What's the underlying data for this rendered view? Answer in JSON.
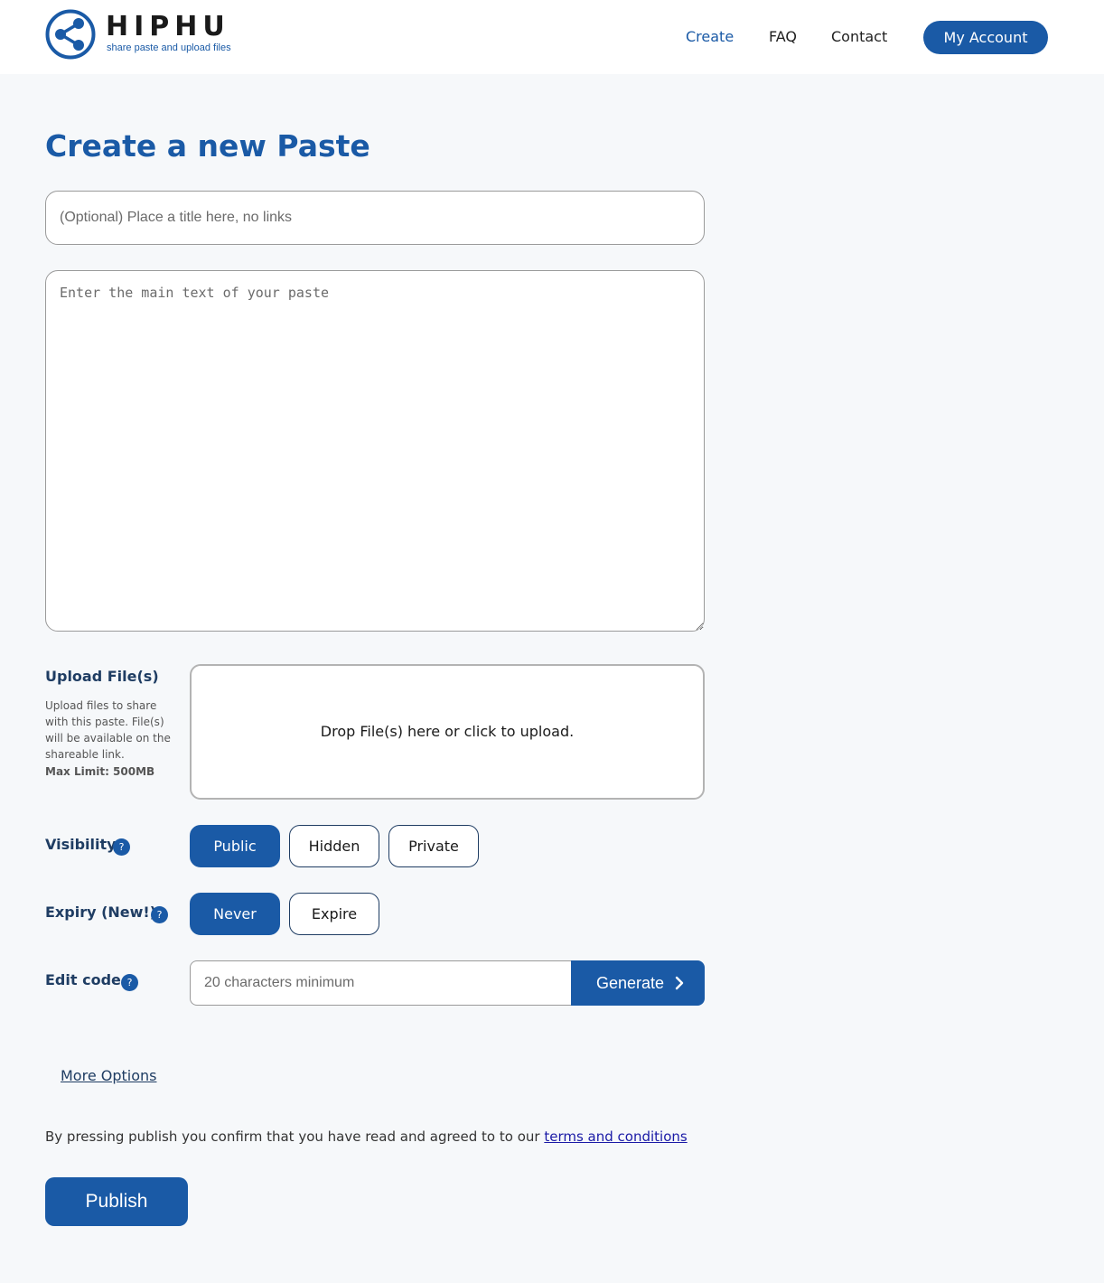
{
  "header": {
    "logo_word": "HIPHU",
    "logo_tagline": "share paste and upload files",
    "nav": {
      "create": "Create",
      "faq": "FAQ",
      "contact": "Contact"
    },
    "account_label": "My Account"
  },
  "main": {
    "title": "Create a new Paste",
    "title_input": {
      "placeholder": "(Optional) Place a title here, no links",
      "value": ""
    },
    "text_area": {
      "placeholder": "Enter the main text of your paste",
      "value": ""
    },
    "upload": {
      "heading": "Upload File(s)",
      "description": "Upload files to share with this paste. File(s) will be available on the shareable link.",
      "limit": "Max Limit: 500MB",
      "dropzone_text": "Drop File(s) here or click to upload."
    },
    "visibility": {
      "label": "Visibility",
      "help": "?",
      "options": [
        "Public",
        "Hidden",
        "Private"
      ],
      "selected": "Public"
    },
    "expiry": {
      "label": "Expiry (New!):",
      "help": "?",
      "options": [
        "Never",
        "Expire"
      ],
      "selected": "Never"
    },
    "edit_code": {
      "label": "Edit code",
      "help": "?",
      "placeholder": "20 characters minimum",
      "value": "",
      "generate_label": "Generate"
    },
    "more_options": "More Options",
    "terms": {
      "prefix": "By pressing publish you confirm that you have read and agreed to to our ",
      "link_text": "terms and conditions"
    },
    "publish_label": "Publish"
  },
  "colors": {
    "brand": "#1a5aa6",
    "background": "#f6f8fa",
    "label": "#1f3d63"
  },
  "icons": {
    "logo": "share-icon",
    "help": "question-icon",
    "generate": "chevron-right-icon"
  }
}
